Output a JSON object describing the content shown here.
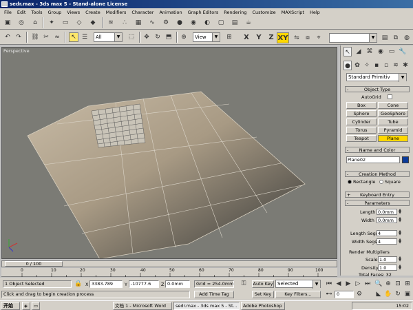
{
  "window": {
    "title": "sedr.max - 3ds max 5 - Stand-alone License"
  },
  "menu": [
    "File",
    "Edit",
    "Tools",
    "Group",
    "Views",
    "Create",
    "Modifiers",
    "Character",
    "Animation",
    "Graph Editors",
    "Rendering",
    "Customize",
    "MAXScript",
    "Help"
  ],
  "toolbar": {
    "selection_filter": "All",
    "reference_coord": "View",
    "axis": [
      "X",
      "Y",
      "Z",
      "XY"
    ],
    "active_axis": "XY",
    "named_selection": ""
  },
  "viewport": {
    "label": "Perspective"
  },
  "command_panel": {
    "category": "Standard Primitiv",
    "object_type": {
      "title": "Object Type",
      "autogrid": "AutoGrid",
      "buttons": [
        "Box",
        "Cone",
        "Sphere",
        "GeoSphere",
        "Cylinder",
        "Tube",
        "Torus",
        "Pyramid",
        "Teapot",
        "Plane"
      ],
      "selected": "Plane"
    },
    "name_color": {
      "title": "Name and Color",
      "name": "Plane02",
      "color": "#0a3a9a"
    },
    "creation_method": {
      "title": "Creation Method",
      "options": [
        "Rectangle",
        "Square"
      ],
      "selected": "Rectangle"
    },
    "keyboard_entry": {
      "title": "Keyboard Entry"
    },
    "parameters": {
      "title": "Parameters",
      "length_label": "Length",
      "length_value": "0.0mm",
      "width_label": "Width",
      "width_value": "0.0mm",
      "length_segs_label": "Length Segs",
      "length_segs_value": "4",
      "width_segs_label": "Width Segs",
      "width_segs_value": "4",
      "render_mult_title": "Render Multipliers",
      "scale_label": "Scale",
      "scale_value": "1.0",
      "density_label": "Density",
      "density_value": "1.0",
      "total_faces": "Total Faces: 32"
    }
  },
  "timeline": {
    "frame": "0 / 100",
    "ticks": [
      "0",
      "10",
      "20",
      "30",
      "40",
      "50",
      "60",
      "70",
      "80",
      "90",
      "100"
    ]
  },
  "status": {
    "selection": "1 Object Selected",
    "prompt": "Click and drag to begin creation process",
    "x_label": "X",
    "x_value": "3383.789",
    "y_label": "Y",
    "y_value": "-10777.6",
    "z_label": "Z",
    "z_value": "0.0mm",
    "grid": "Grid = 254.0mm",
    "add_time_tag": "Add Time Tag",
    "auto_key": "Auto Key",
    "set_key": "Set Key",
    "key_mode": "Selected",
    "key_filters": "Key Filters...",
    "frame_value": "0"
  },
  "taskbar": {
    "start": "开始",
    "tasks": [
      "文档 1 - Microsoft Word",
      "sedr.max - 3ds max 5 - St...",
      "Adobe Photoshop"
    ],
    "active_task": 1,
    "clock": "15:02"
  }
}
